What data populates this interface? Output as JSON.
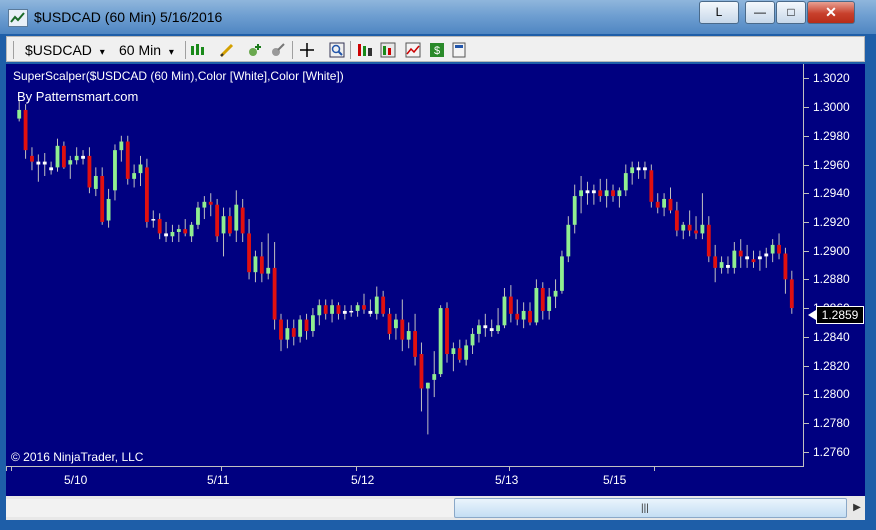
{
  "window": {
    "title": "$USDCAD (60 Min)  5/16/2016",
    "link_button": "L",
    "minimize_glyph": "—",
    "maximize_glyph": "□",
    "close_glyph": "✕"
  },
  "toolbar": {
    "instrument": "$USDCAD",
    "interval": "60 Min",
    "dropdown_glyph": "▾",
    "icons": [
      "bar-type-icon",
      "drawing-pencil-icon",
      "add-indicator-icon",
      "strategy-icon",
      "crosshair-icon",
      "zoom-icon",
      "data-box-icon",
      "chart-trader-icon",
      "properties-icon",
      "dollar-icon",
      "templates-icon"
    ]
  },
  "chart": {
    "indicator_label": "SuperScalper($USDCAD (60 Min),Color [White],Color [White])",
    "author_label": "By Patternsmart.com",
    "copyright": "© 2016 NinjaTrader, LLC",
    "last_price": "1.2859",
    "colors": {
      "background": "#000080",
      "up": "#90ee90",
      "down": "#e01010",
      "neutral": "#ffffff",
      "wick": "#c0c0c0"
    }
  },
  "chart_data": {
    "type": "candlestick",
    "y_axis": {
      "min": 1.275,
      "max": 1.303,
      "ticks": [
        "1.3020",
        "1.3000",
        "1.2980",
        "1.2960",
        "1.2940",
        "1.2920",
        "1.2900",
        "1.2880",
        "1.2860",
        "1.2840",
        "1.2820",
        "1.2800",
        "1.2780",
        "1.2760"
      ]
    },
    "x_axis": {
      "labels": [
        "5/10",
        "5/11",
        "5/12",
        "5/13",
        "5/15"
      ]
    },
    "candles": [
      [
        1.2992,
        1.3005,
        1.299,
        1.2998
      ],
      [
        1.2998,
        1.3002,
        1.2964,
        1.297
      ],
      [
        1.2966,
        1.2972,
        1.2956,
        1.2962
      ],
      [
        1.2962,
        1.2967,
        1.2948,
        1.296
      ],
      [
        1.296,
        1.2968,
        1.2952,
        1.2962
      ],
      [
        1.2958,
        1.2962,
        1.2953,
        1.2956
      ],
      [
        1.2958,
        1.2978,
        1.2955,
        1.2973
      ],
      [
        1.2973,
        1.2976,
        1.2957,
        1.2958
      ],
      [
        1.296,
        1.2966,
        1.295,
        1.2963
      ],
      [
        1.2963,
        1.2972,
        1.296,
        1.2966
      ],
      [
        1.2966,
        1.297,
        1.296,
        1.2964
      ],
      [
        1.2966,
        1.2972,
        1.294,
        1.2944
      ],
      [
        1.2943,
        1.2958,
        1.2938,
        1.2952
      ],
      [
        1.2952,
        1.2958,
        1.2918,
        1.292
      ],
      [
        1.2921,
        1.2943,
        1.2916,
        1.2936
      ],
      [
        1.2942,
        1.2974,
        1.2935,
        1.297
      ],
      [
        1.297,
        1.298,
        1.2962,
        1.2976
      ],
      [
        1.2976,
        1.298,
        1.2946,
        1.295
      ],
      [
        1.295,
        1.296,
        1.2944,
        1.2954
      ],
      [
        1.2954,
        1.2966,
        1.2945,
        1.296
      ],
      [
        1.2958,
        1.2964,
        1.2916,
        1.292
      ],
      [
        1.2922,
        1.2928,
        1.2916,
        1.2922
      ],
      [
        1.2922,
        1.2926,
        1.2908,
        1.2912
      ],
      [
        1.2912,
        1.292,
        1.2906,
        1.291
      ],
      [
        1.291,
        1.2918,
        1.2906,
        1.2913
      ],
      [
        1.2913,
        1.2918,
        1.2906,
        1.2915
      ],
      [
        1.2915,
        1.2922,
        1.291,
        1.2912
      ],
      [
        1.291,
        1.292,
        1.2906,
        1.2918
      ],
      [
        1.2918,
        1.2934,
        1.2915,
        1.293
      ],
      [
        1.293,
        1.2938,
        1.2922,
        1.2934
      ],
      [
        1.2934,
        1.294,
        1.2924,
        1.2932
      ],
      [
        1.2932,
        1.2936,
        1.2906,
        1.291
      ],
      [
        1.2912,
        1.293,
        1.2896,
        1.2924
      ],
      [
        1.2924,
        1.293,
        1.291,
        1.2912
      ],
      [
        1.2914,
        1.2942,
        1.2906,
        1.2932
      ],
      [
        1.293,
        1.2936,
        1.2906,
        1.2912
      ],
      [
        1.2912,
        1.2922,
        1.288,
        1.2885
      ],
      [
        1.2885,
        1.29,
        1.2878,
        1.2896
      ],
      [
        1.2896,
        1.2906,
        1.2878,
        1.2884
      ],
      [
        1.2884,
        1.2912,
        1.288,
        1.2888
      ],
      [
        1.2888,
        1.2906,
        1.2845,
        1.2852
      ],
      [
        1.2852,
        1.2856,
        1.283,
        1.2838
      ],
      [
        1.2838,
        1.2852,
        1.2832,
        1.2846
      ],
      [
        1.2846,
        1.2852,
        1.2834,
        1.284
      ],
      [
        1.284,
        1.2855,
        1.2836,
        1.2852
      ],
      [
        1.2852,
        1.2856,
        1.2838,
        1.2844
      ],
      [
        1.2844,
        1.286,
        1.284,
        1.2855
      ],
      [
        1.2855,
        1.2866,
        1.2848,
        1.2862
      ],
      [
        1.2862,
        1.2866,
        1.2852,
        1.2856
      ],
      [
        1.2856,
        1.2866,
        1.285,
        1.2862
      ],
      [
        1.2862,
        1.2864,
        1.2852,
        1.2856
      ],
      [
        1.2856,
        1.2862,
        1.2852,
        1.2858
      ],
      [
        1.2858,
        1.2862,
        1.2854,
        1.2857
      ],
      [
        1.2858,
        1.2864,
        1.2854,
        1.2862
      ],
      [
        1.2862,
        1.287,
        1.2856,
        1.2859
      ],
      [
        1.2858,
        1.2866,
        1.2854,
        1.2856
      ],
      [
        1.2856,
        1.2875,
        1.2852,
        1.2868
      ],
      [
        1.2868,
        1.2872,
        1.2854,
        1.2856
      ],
      [
        1.2856,
        1.286,
        1.2838,
        1.2842
      ],
      [
        1.2846,
        1.2856,
        1.2838,
        1.2852
      ],
      [
        1.2852,
        1.2866,
        1.283,
        1.2838
      ],
      [
        1.2838,
        1.285,
        1.2832,
        1.2844
      ],
      [
        1.2844,
        1.2856,
        1.282,
        1.2826
      ],
      [
        1.2828,
        1.2836,
        1.2788,
        1.2804
      ],
      [
        1.2804,
        1.2808,
        1.2772,
        1.2808
      ],
      [
        1.281,
        1.283,
        1.2798,
        1.2814
      ],
      [
        1.2814,
        1.2862,
        1.2812,
        1.286
      ],
      [
        1.286,
        1.2864,
        1.2822,
        1.2828
      ],
      [
        1.2828,
        1.2836,
        1.2816,
        1.2832
      ],
      [
        1.2832,
        1.2838,
        1.2822,
        1.2824
      ],
      [
        1.2824,
        1.2838,
        1.282,
        1.2834
      ],
      [
        1.2834,
        1.2846,
        1.2828,
        1.2842
      ],
      [
        1.2842,
        1.2852,
        1.2836,
        1.2848
      ],
      [
        1.2848,
        1.2856,
        1.284,
        1.2846
      ],
      [
        1.2846,
        1.2852,
        1.284,
        1.2844
      ],
      [
        1.2844,
        1.286,
        1.2842,
        1.2848
      ],
      [
        1.2848,
        1.2874,
        1.2846,
        1.2868
      ],
      [
        1.2868,
        1.2876,
        1.285,
        1.2856
      ],
      [
        1.2856,
        1.2866,
        1.2848,
        1.2852
      ],
      [
        1.2852,
        1.2864,
        1.2846,
        1.2858
      ],
      [
        1.2858,
        1.2864,
        1.2848,
        1.285
      ],
      [
        1.285,
        1.288,
        1.2848,
        1.2874
      ],
      [
        1.2874,
        1.2878,
        1.2852,
        1.2858
      ],
      [
        1.2858,
        1.2874,
        1.2852,
        1.2868
      ],
      [
        1.2868,
        1.288,
        1.286,
        1.2872
      ],
      [
        1.2872,
        1.29,
        1.287,
        1.2896
      ],
      [
        1.2896,
        1.2924,
        1.2892,
        1.2918
      ],
      [
        1.2918,
        1.2946,
        1.2912,
        1.2938
      ],
      [
        1.2938,
        1.2952,
        1.2926,
        1.2942
      ],
      [
        1.2942,
        1.2948,
        1.2932,
        1.294
      ],
      [
        1.294,
        1.2946,
        1.2932,
        1.2942
      ],
      [
        1.2942,
        1.295,
        1.2934,
        1.2938
      ],
      [
        1.2938,
        1.295,
        1.293,
        1.2942
      ],
      [
        1.2942,
        1.2946,
        1.2934,
        1.2938
      ],
      [
        1.2938,
        1.2944,
        1.293,
        1.2942
      ],
      [
        1.2942,
        1.296,
        1.2938,
        1.2954
      ],
      [
        1.2954,
        1.2962,
        1.2946,
        1.2958
      ],
      [
        1.2958,
        1.2962,
        1.295,
        1.2956
      ],
      [
        1.2958,
        1.2962,
        1.295,
        1.2956
      ],
      [
        1.2956,
        1.296,
        1.293,
        1.2934
      ],
      [
        1.2934,
        1.294,
        1.2926,
        1.293
      ],
      [
        1.293,
        1.294,
        1.2924,
        1.2936
      ],
      [
        1.2936,
        1.2944,
        1.2926,
        1.2928
      ],
      [
        1.2928,
        1.2934,
        1.291,
        1.2914
      ],
      [
        1.2914,
        1.292,
        1.2908,
        1.2918
      ],
      [
        1.2918,
        1.2928,
        1.291,
        1.2914
      ],
      [
        1.2914,
        1.2924,
        1.2908,
        1.2912
      ],
      [
        1.2912,
        1.294,
        1.2908,
        1.2918
      ],
      [
        1.2918,
        1.2924,
        1.2892,
        1.2896
      ],
      [
        1.2896,
        1.2904,
        1.2878,
        1.2888
      ],
      [
        1.2888,
        1.2896,
        1.2884,
        1.2892
      ],
      [
        1.289,
        1.2896,
        1.2884,
        1.2888
      ],
      [
        1.2888,
        1.2906,
        1.2884,
        1.29
      ],
      [
        1.29,
        1.2908,
        1.2888,
        1.2896
      ],
      [
        1.2896,
        1.2904,
        1.2888,
        1.2894
      ],
      [
        1.2894,
        1.29,
        1.2888,
        1.2892
      ],
      [
        1.2894,
        1.29,
        1.2886,
        1.2896
      ],
      [
        1.2896,
        1.2902,
        1.2888,
        1.2898
      ],
      [
        1.2898,
        1.2908,
        1.2892,
        1.2904
      ],
      [
        1.2904,
        1.2912,
        1.2894,
        1.2898
      ],
      [
        1.2898,
        1.2902,
        1.287,
        1.288
      ],
      [
        1.288,
        1.2886,
        1.2856,
        1.286
      ]
    ]
  }
}
